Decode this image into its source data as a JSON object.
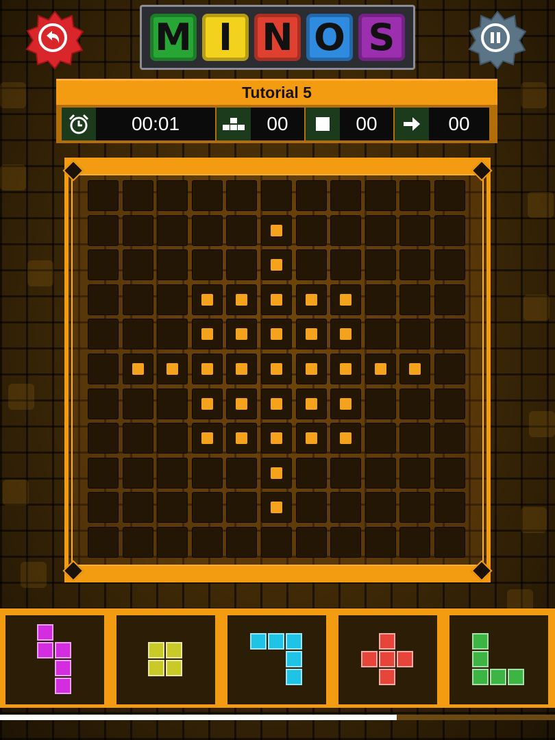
{
  "game_title_letters": [
    {
      "letter": "M",
      "color": "#27a635"
    },
    {
      "letter": "I",
      "color": "#f2d21d"
    },
    {
      "letter": "N",
      "color": "#e0402f"
    },
    {
      "letter": "O",
      "color": "#2f8be0"
    },
    {
      "letter": "S",
      "color": "#9b2fb0"
    }
  ],
  "back_button": {
    "icon": "undo-arrow-icon",
    "color": "#d8262b"
  },
  "pause_button": {
    "icon": "pause-icon",
    "color": "#5b7486"
  },
  "level_title": "Tutorial 5",
  "stats": {
    "timer": {
      "icon": "alarm-clock-icon",
      "value": "00:01"
    },
    "pieces": {
      "icon": "pieces-icon",
      "value": "00"
    },
    "blocks": {
      "icon": "square-icon",
      "value": "00"
    },
    "moves": {
      "icon": "arrow-right-icon",
      "value": "00"
    }
  },
  "board": {
    "rows": 11,
    "cols": 11,
    "target_cells": [
      [
        1,
        5
      ],
      [
        2,
        5
      ],
      [
        3,
        3
      ],
      [
        3,
        4
      ],
      [
        3,
        5
      ],
      [
        3,
        6
      ],
      [
        3,
        7
      ],
      [
        4,
        3
      ],
      [
        4,
        4
      ],
      [
        4,
        5
      ],
      [
        4,
        6
      ],
      [
        4,
        7
      ],
      [
        5,
        1
      ],
      [
        5,
        2
      ],
      [
        5,
        3
      ],
      [
        5,
        4
      ],
      [
        5,
        5
      ],
      [
        5,
        6
      ],
      [
        5,
        7
      ],
      [
        5,
        8
      ],
      [
        5,
        9
      ],
      [
        6,
        3
      ],
      [
        6,
        4
      ],
      [
        6,
        5
      ],
      [
        6,
        6
      ],
      [
        6,
        7
      ],
      [
        7,
        3
      ],
      [
        7,
        4
      ],
      [
        7,
        5
      ],
      [
        7,
        6
      ],
      [
        7,
        7
      ],
      [
        8,
        5
      ],
      [
        9,
        5
      ]
    ],
    "target_color": "#f5a31c"
  },
  "pieces_tray": [
    {
      "name": "magenta-s-piece",
      "color": "#d42de0",
      "cells": [
        [
          0,
          0
        ],
        [
          1,
          0
        ],
        [
          1,
          1
        ],
        [
          2,
          1
        ],
        [
          3,
          1
        ]
      ]
    },
    {
      "name": "yellow-square-piece",
      "color": "#c9c928",
      "cells": [
        [
          0,
          0
        ],
        [
          0,
          1
        ],
        [
          1,
          0
        ],
        [
          1,
          1
        ]
      ]
    },
    {
      "name": "cyan-hook-piece",
      "color": "#1fc3e6",
      "cells": [
        [
          0,
          0
        ],
        [
          0,
          1
        ],
        [
          0,
          2
        ],
        [
          1,
          2
        ],
        [
          2,
          2
        ]
      ]
    },
    {
      "name": "red-plus-piece",
      "color": "#e8453a",
      "cells": [
        [
          0,
          1
        ],
        [
          1,
          0
        ],
        [
          1,
          1
        ],
        [
          1,
          2
        ],
        [
          2,
          1
        ]
      ]
    },
    {
      "name": "green-l-piece",
      "color": "#3cb544",
      "cells": [
        [
          0,
          0
        ],
        [
          1,
          0
        ],
        [
          2,
          0
        ],
        [
          2,
          1
        ],
        [
          2,
          2
        ]
      ]
    }
  ],
  "progress_fraction": 0.715
}
